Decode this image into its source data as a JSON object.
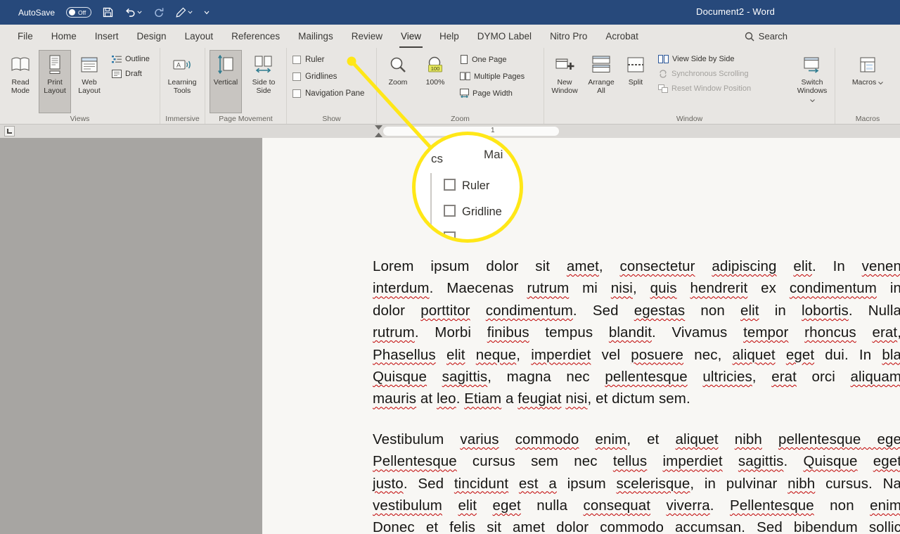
{
  "title_bar": {
    "autosave_label": "AutoSave",
    "autosave_state": "Off",
    "title": "Document2 - Word"
  },
  "search": {
    "label": "Search"
  },
  "tabs": [
    {
      "label": "File",
      "active": false
    },
    {
      "label": "Home",
      "active": false
    },
    {
      "label": "Insert",
      "active": false
    },
    {
      "label": "Design",
      "active": false
    },
    {
      "label": "Layout",
      "active": false
    },
    {
      "label": "References",
      "active": false
    },
    {
      "label": "Mailings",
      "active": false
    },
    {
      "label": "Review",
      "active": false
    },
    {
      "label": "View",
      "active": true
    },
    {
      "label": "Help",
      "active": false
    },
    {
      "label": "DYMO Label",
      "active": false
    },
    {
      "label": "Nitro Pro",
      "active": false
    },
    {
      "label": "Acrobat",
      "active": false
    }
  ],
  "ribbon": {
    "views": {
      "label": "Views",
      "read_mode": "Read Mode",
      "print_layout": "Print Layout",
      "web_layout": "Web Layout",
      "outline": "Outline",
      "draft": "Draft"
    },
    "immersive": {
      "label": "Immersive",
      "learning_tools": "Learning Tools"
    },
    "page_movement": {
      "label": "Page Movement",
      "vertical": "Vertical",
      "side_to_side": "Side to Side"
    },
    "show": {
      "label": "Show",
      "ruler": "Ruler",
      "gridlines": "Gridlines",
      "navigation_pane": "Navigation Pane"
    },
    "zoom": {
      "label": "Zoom",
      "zoom": "Zoom",
      "hundred": "100%",
      "one_page": "One Page",
      "multiple_pages": "Multiple Pages",
      "page_width": "Page Width"
    },
    "window": {
      "label": "Window",
      "new_window": "New Window",
      "arrange_all": "Arrange All",
      "split": "Split",
      "side_by_side": "View Side by Side",
      "sync_scrolling": "Synchronous Scrolling",
      "reset_position": "Reset Window Position",
      "switch_windows": "Switch Windows"
    },
    "macros": {
      "label": "Macros",
      "macros": "Macros"
    }
  },
  "ruler_strip": {
    "tick": "1"
  },
  "callout": {
    "left_text": "cs",
    "right_text": "Mai",
    "checkbox1": "Ruler",
    "checkbox2": "Gridline"
  },
  "colors": {
    "titlebar_blue": "#27497b",
    "ribbon_bg": "#e8e6e3",
    "doc_bg": "#a7a5a2",
    "page_bg": "#f8f7f4",
    "accent_yellow": "#ffe717",
    "squiggle_red": "#c00000",
    "selected_button": "#c8c5c1"
  },
  "document": {
    "paragraphs": [
      {
        "lines": [
          {
            "full": true,
            "segs": [
              [
                "Lorem ipsum dolor sit ",
                0
              ],
              [
                "amet",
                1
              ],
              [
                ", ",
                0
              ],
              [
                "consectetur",
                1
              ],
              [
                " ",
                0
              ],
              [
                "adipiscing",
                1
              ],
              [
                " ",
                0
              ],
              [
                "elit",
                1
              ],
              [
                ". In ",
                0
              ],
              [
                "venen",
                1
              ]
            ]
          },
          {
            "full": true,
            "segs": [
              [
                "interdum",
                1
              ],
              [
                ". Maecenas ",
                0
              ],
              [
                "rutrum",
                1
              ],
              [
                " mi ",
                0
              ],
              [
                "nisi",
                1
              ],
              [
                ", ",
                0
              ],
              [
                "quis",
                1
              ],
              [
                " ",
                0
              ],
              [
                "hendrerit",
                1
              ],
              [
                " ex ",
                0
              ],
              [
                "condimentum",
                1
              ],
              [
                " in",
                0
              ]
            ]
          },
          {
            "full": true,
            "segs": [
              [
                "dolor ",
                0
              ],
              [
                "porttitor",
                1
              ],
              [
                " ",
                0
              ],
              [
                "condimentum",
                1
              ],
              [
                ". Sed ",
                0
              ],
              [
                "egestas",
                1
              ],
              [
                " non ",
                0
              ],
              [
                "elit",
                1
              ],
              [
                " in ",
                0
              ],
              [
                "lobortis",
                1
              ],
              [
                ". Nulla",
                0
              ]
            ]
          },
          {
            "full": true,
            "segs": [
              [
                "rutrum",
                1
              ],
              [
                ". Morbi ",
                0
              ],
              [
                "finibus",
                1
              ],
              [
                " tempus ",
                0
              ],
              [
                "blandit",
                1
              ],
              [
                ". Vivamus ",
                0
              ],
              [
                "tempor",
                1
              ],
              [
                " ",
                0
              ],
              [
                "rhoncus",
                1
              ],
              [
                " ",
                0
              ],
              [
                "erat",
                1
              ],
              [
                ",",
                0
              ]
            ]
          },
          {
            "full": true,
            "segs": [
              [
                "Phasellus",
                1
              ],
              [
                " ",
                0
              ],
              [
                "elit",
                1
              ],
              [
                " ",
                0
              ],
              [
                "neque",
                1
              ],
              [
                ", ",
                0
              ],
              [
                "imperdiet",
                1
              ],
              [
                " vel ",
                0
              ],
              [
                "posuere",
                1
              ],
              [
                " nec, ",
                0
              ],
              [
                "aliquet",
                1
              ],
              [
                " ",
                0
              ],
              [
                "eget",
                1
              ],
              [
                " dui. In ",
                0
              ],
              [
                "bla",
                1
              ]
            ]
          },
          {
            "full": true,
            "segs": [
              [
                "Quisque",
                1
              ],
              [
                " ",
                0
              ],
              [
                "sagittis",
                1
              ],
              [
                ", magna nec ",
                0
              ],
              [
                "pellentesque",
                1
              ],
              [
                " ",
                0
              ],
              [
                "ultricies",
                1
              ],
              [
                ", ",
                0
              ],
              [
                "erat",
                1
              ],
              [
                " orci ",
                0
              ],
              [
                "aliquam",
                1
              ]
            ]
          },
          {
            "full": false,
            "segs": [
              [
                "mauris",
                1
              ],
              [
                " at ",
                0
              ],
              [
                "leo",
                1
              ],
              [
                ". ",
                0
              ],
              [
                "Etiam",
                1
              ],
              [
                " a ",
                0
              ],
              [
                "feugiat",
                1
              ],
              [
                " ",
                0
              ],
              [
                "nisi",
                1
              ],
              [
                ", et dictum sem.",
                0
              ]
            ]
          }
        ]
      },
      {
        "lines": [
          {
            "full": true,
            "segs": [
              [
                "Vestibulum ",
                0
              ],
              [
                "varius",
                1
              ],
              [
                " ",
                0
              ],
              [
                "commodo",
                1
              ],
              [
                " ",
                0
              ],
              [
                "enim",
                1
              ],
              [
                ", et ",
                0
              ],
              [
                "aliquet",
                1
              ],
              [
                " ",
                0
              ],
              [
                "nibh",
                1
              ],
              [
                " ",
                0
              ],
              [
                "pellentesque",
                1
              ],
              [
                " ege",
                1
              ]
            ]
          },
          {
            "full": true,
            "segs": [
              [
                "Pellentesque",
                1
              ],
              [
                " cursus sem nec ",
                0
              ],
              [
                "tellus",
                1
              ],
              [
                " ",
                0
              ],
              [
                "imperdiet",
                1
              ],
              [
                " ",
                0
              ],
              [
                "sagittis",
                1
              ],
              [
                ". ",
                0
              ],
              [
                "Quisque",
                1
              ],
              [
                " ",
                0
              ],
              [
                "eget",
                1
              ]
            ]
          },
          {
            "full": true,
            "segs": [
              [
                "justo",
                1
              ],
              [
                ". Sed ",
                0
              ],
              [
                "tincidunt",
                1
              ],
              [
                " ",
                0
              ],
              [
                "est a",
                1
              ],
              [
                " ipsum ",
                0
              ],
              [
                "scelerisque",
                1
              ],
              [
                ", in pulvinar ",
                0
              ],
              [
                "nibh",
                1
              ],
              [
                " cursus. Na",
                0
              ]
            ]
          },
          {
            "full": true,
            "segs": [
              [
                "vestibulum",
                1
              ],
              [
                " ",
                0
              ],
              [
                "elit",
                1
              ],
              [
                " ",
                0
              ],
              [
                "eget",
                1
              ],
              [
                " nulla ",
                0
              ],
              [
                "consequat",
                1
              ],
              [
                " ",
                0
              ],
              [
                "viverra",
                1
              ],
              [
                ". ",
                0
              ],
              [
                "Pellentesque",
                1
              ],
              [
                " non ",
                0
              ],
              [
                "enim",
                1
              ]
            ]
          },
          {
            "full": true,
            "segs": [
              [
                "Donec et felis sit amet dolor commodo accumsan. Sed bibendum sollic",
                0
              ]
            ]
          }
        ]
      }
    ]
  }
}
